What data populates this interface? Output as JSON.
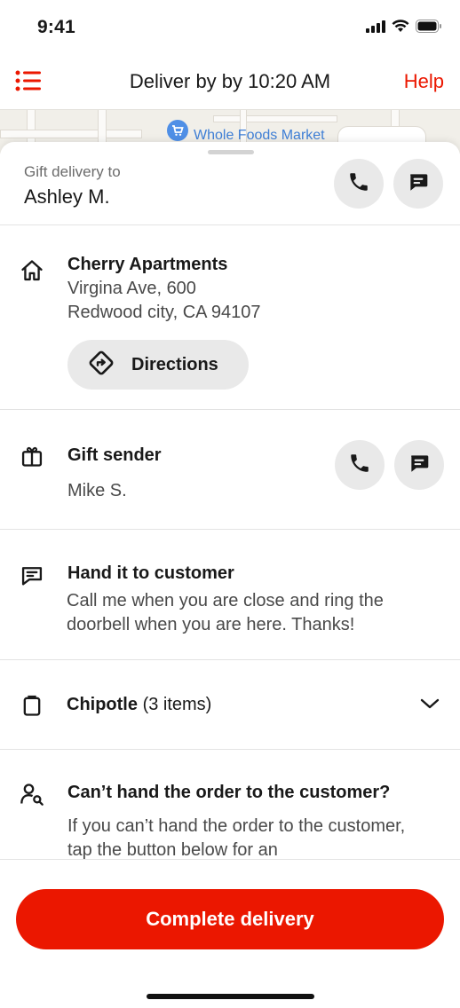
{
  "status_bar": {
    "time": "9:41"
  },
  "nav": {
    "title": "Deliver by by 10:20 AM",
    "help_label": "Help"
  },
  "map": {
    "place_label": "Whole Foods Market"
  },
  "recipient": {
    "caption": "Gift delivery to",
    "name": "Ashley M."
  },
  "address": {
    "building": "Cherry Apartments",
    "line1": "Virgina Ave, 600",
    "line2": "Redwood city, CA 94107",
    "directions_label": "Directions"
  },
  "gift_sender": {
    "title": "Gift sender",
    "name": "Mike S."
  },
  "instructions": {
    "title": "Hand it to customer",
    "text": "Call me when you are close and ring the doorbell when you are here. Thanks!"
  },
  "order": {
    "store": "Chipotle",
    "count": "(3 items)"
  },
  "problem": {
    "title": "Can’t hand the order to the customer?",
    "text": "If you can’t hand the order to the customer, tap the button below for an"
  },
  "footer": {
    "complete_label": "Complete delivery"
  },
  "colors": {
    "accent": "#eb1700",
    "button_bg": "#e9e9e9",
    "map_pin": "#4f8fe6"
  }
}
